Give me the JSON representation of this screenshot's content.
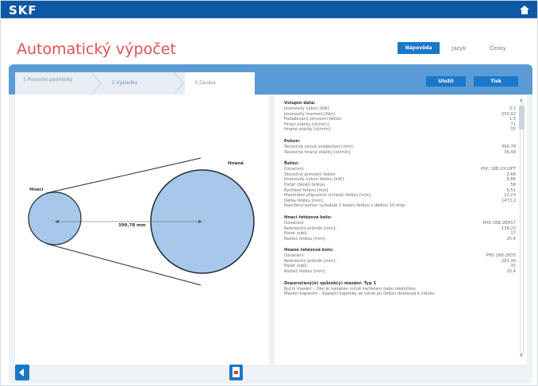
{
  "app": {
    "brand": "SKF"
  },
  "header": {
    "title": "Automatický výpočet",
    "help_label": "Nápověda",
    "language": "Jazyk",
    "language_value": "Česky"
  },
  "tabs": [
    {
      "label": "1 Provozní podmínky"
    },
    {
      "label": "2 Výsledky"
    },
    {
      "label": "3 Závěre"
    }
  ],
  "actions": {
    "save_label": "Uložit",
    "print_label": "Tisk"
  },
  "diagram": {
    "driving_label": "Hnací",
    "driven_label": "Hnaná",
    "distance_label": "399,78 mm"
  },
  "results": {
    "sections": [
      {
        "title": "Vstupní data:",
        "rows": [
          {
            "k": "Jmenovitý výkon [kW]",
            "v": "3,2"
          },
          {
            "k": "Jmenovitý moment [Nm]",
            "v": "250,92"
          },
          {
            "k": "Požadovaný provozní faktor:",
            "v": "1,5"
          },
          {
            "k": "Hnací otáčky [ot/min]:",
            "v": "71"
          },
          {
            "k": "Hnané otáčky [ot/min]:",
            "v": "35"
          }
        ]
      },
      {
        "title": "Pohon:",
        "rows": [
          {
            "k": "Skutečná osová vzdálenost [mm]:",
            "v": "399,78"
          },
          {
            "k": "Skutečné hnané otáčky [ot/min]:",
            "v": "34,49"
          }
        ]
      },
      {
        "title": "Řetěz:",
        "rows": [
          {
            "k": "Označení:",
            "v": "PHC 16B-2X10FT"
          },
          {
            "k": "Skutečný provozní faktor:",
            "v": "2,66"
          },
          {
            "k": "Jmenovitý výkon řetězu [kW]:",
            "v": "5,86"
          },
          {
            "k": "Počet článků řetězu:",
            "v": "58"
          },
          {
            "k": "Rychlost řetězu [m/s]:",
            "v": "0,51"
          },
          {
            "k": "Maximální přípustná rychlost řetězu [m/s]:",
            "v": "15,23"
          },
          {
            "k": "Délka řetězu [mm]:",
            "v": "1473,2"
          },
          {
            "k": "Navržený pohon vyžaduje 1 balení řetězu s délkou 10 stop",
            "v": ""
          }
        ]
      },
      {
        "title": "Hnací řetězové kolo:",
        "rows": [
          {
            "k": "Označení:",
            "v": "PHS 16B-2BH17"
          },
          {
            "k": "Referenční průměr [mm]:",
            "v": "138,23"
          },
          {
            "k": "Počet zubů:",
            "v": "17"
          },
          {
            "k": "Rozteč řetězu [mm]:",
            "v": "25,4"
          }
        ]
      },
      {
        "title": "Hnané řetězové kolo:",
        "rows": [
          {
            "k": "Označení:",
            "v": "PHS 16B-2B35"
          },
          {
            "k": "Referenční průměr [mm]:",
            "v": "283,36"
          },
          {
            "k": "Počet zubů:",
            "v": "35"
          },
          {
            "k": "Rozteč řetězu [mm]:",
            "v": "25,4"
          }
        ]
      },
      {
        "title": "Doporučený(é) způsob(y) mazání: Typ 1",
        "rows": [
          {
            "k": "Ruční mazání – Olej je nanášen ručně kartáčem nebo olejničkou",
            "v": ""
          },
          {
            "k": "Mazání kapáním – Kapající kapénky se volně po řetězu dostávají k článku",
            "v": ""
          }
        ]
      }
    ]
  }
}
